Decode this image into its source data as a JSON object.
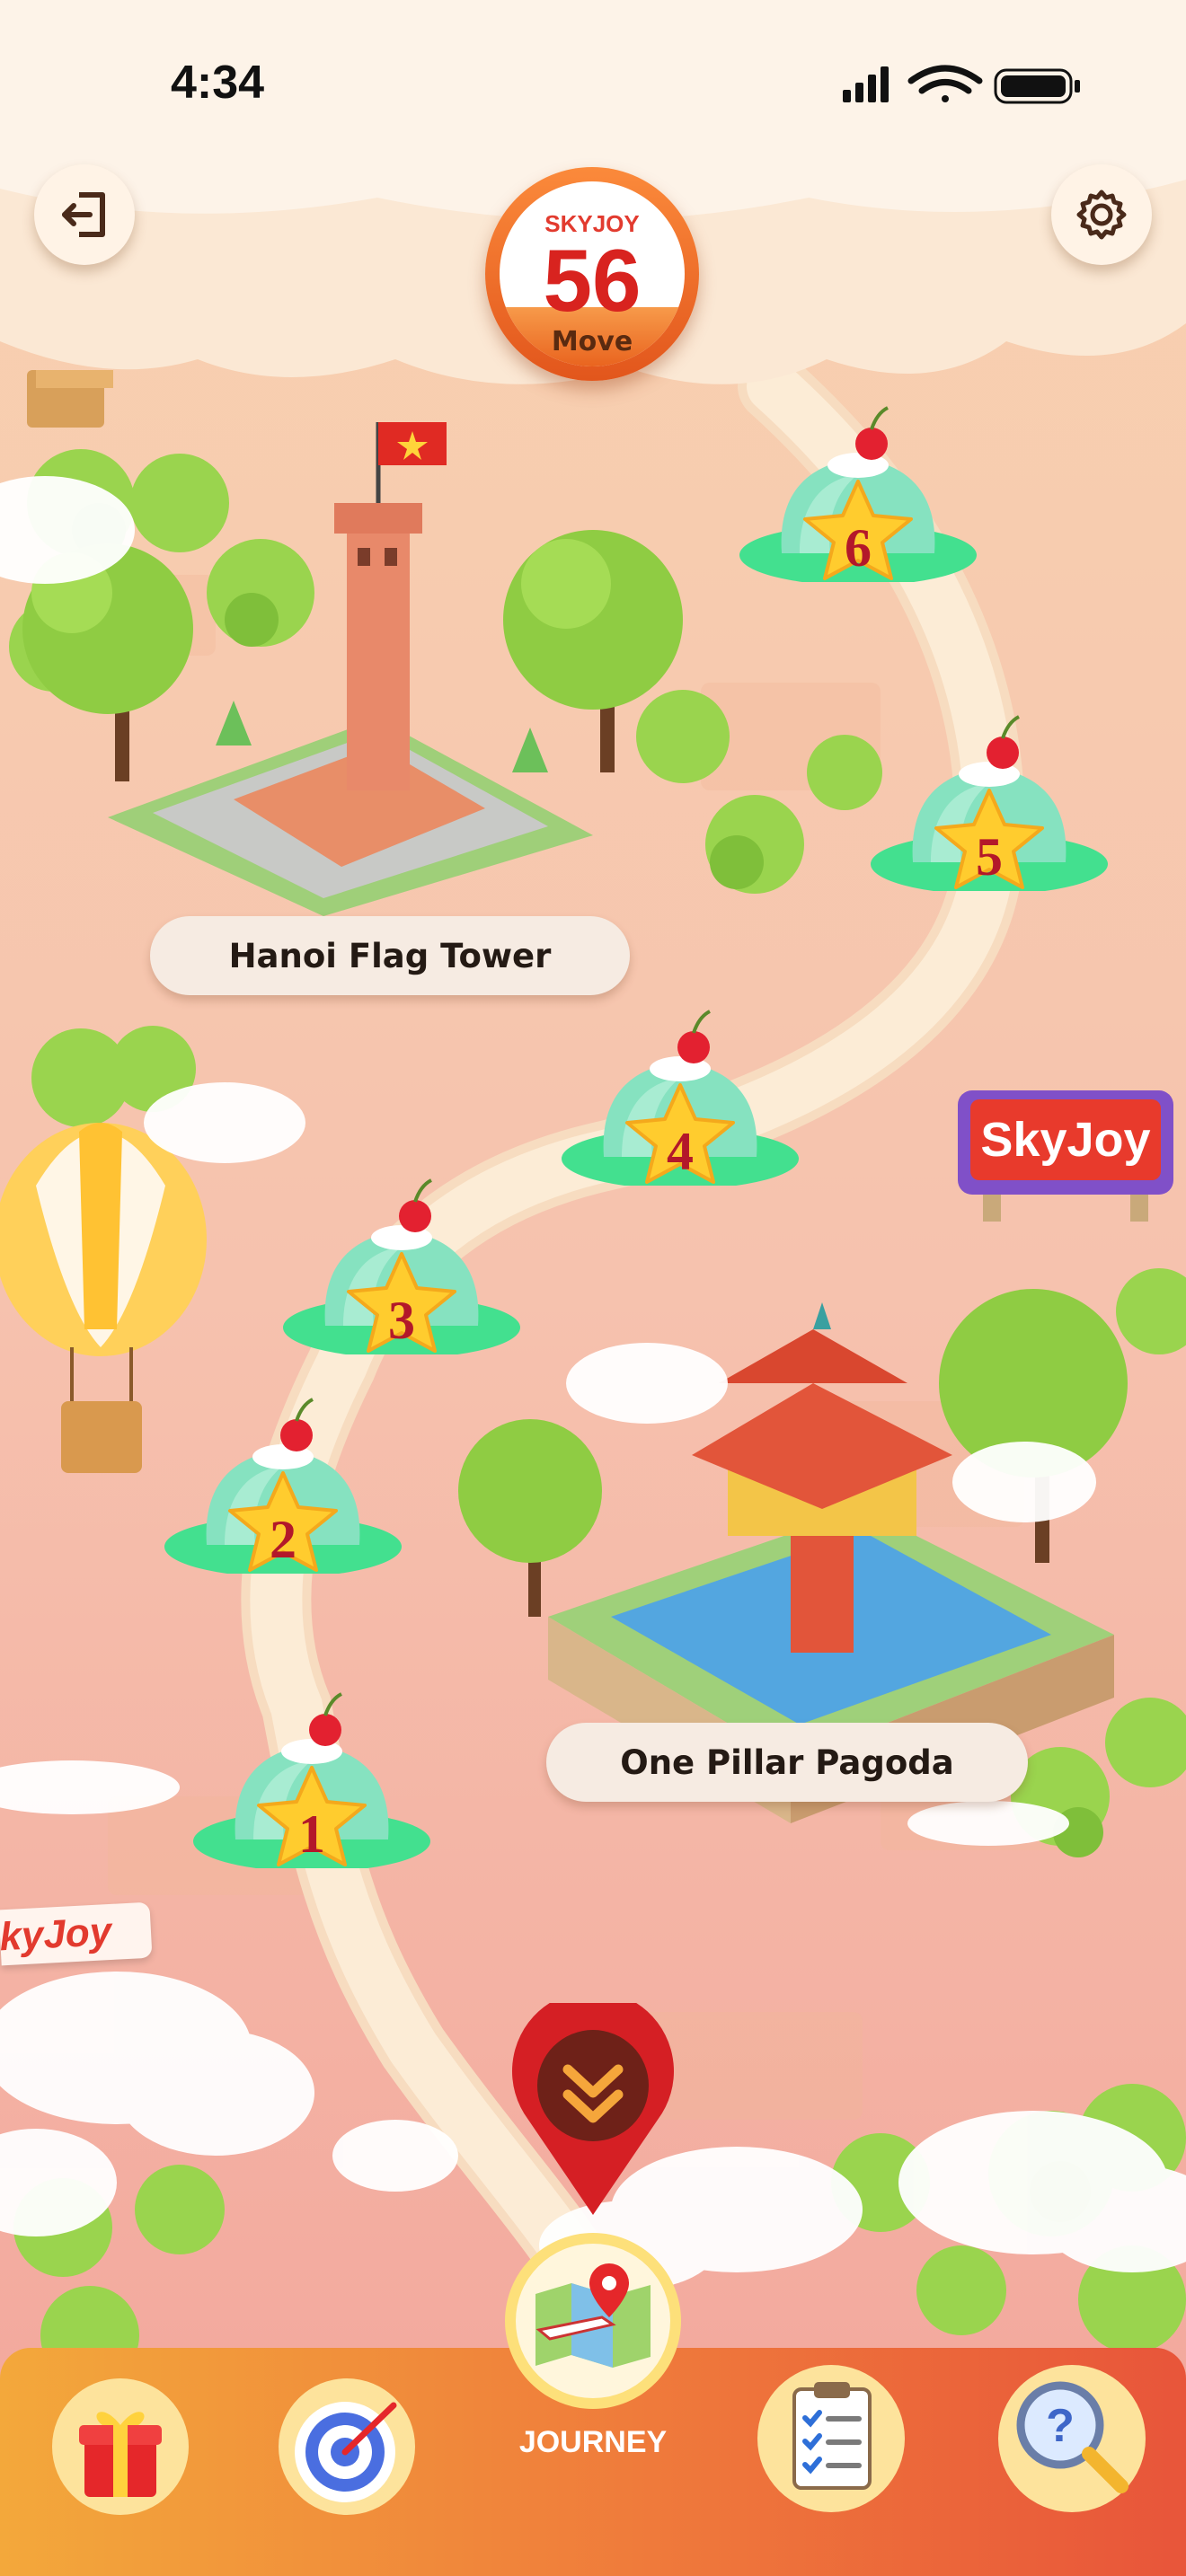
{
  "status_bar": {
    "time": "4:34"
  },
  "header": {
    "exit_icon": "exit-door-icon",
    "settings_icon": "gear-icon",
    "move_counter": {
      "brand": "SKYJOY",
      "count": "56",
      "label": "Move"
    }
  },
  "map": {
    "landmarks": [
      {
        "name": "Hanoi Flag Tower"
      },
      {
        "name": "One Pillar Pagoda"
      }
    ],
    "levels": [
      "1",
      "2",
      "3",
      "4",
      "5",
      "6"
    ],
    "billboard_text": "SkyJoy",
    "banner_text": "SkyJoy"
  },
  "bottom_nav": {
    "items": [
      {
        "icon": "gift-icon"
      },
      {
        "icon": "target-icon"
      },
      {
        "icon": "journey-map-icon",
        "label": "JOURNEY"
      },
      {
        "icon": "checklist-icon"
      },
      {
        "icon": "help-magnifier-icon"
      }
    ],
    "scroll_down_icon": "double-chevron-down-icon"
  },
  "colors": {
    "background": "#f4c7b0",
    "path": "#fbe6cc",
    "level_jelly": "#7fe0b8",
    "accent_red": "#d8231f",
    "nav_orange": "#ef7a3b"
  }
}
